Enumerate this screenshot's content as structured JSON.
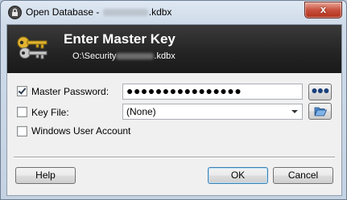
{
  "window": {
    "title_prefix": "Open Database - ",
    "title_suffix": ".kdbx",
    "close_glyph": "x"
  },
  "banner": {
    "title": "Enter Master Key",
    "path_prefix": "O:\\Security",
    "path_suffix": ".kdbx"
  },
  "form": {
    "master_password": {
      "label": "Master Password:",
      "checked": true,
      "value": "●●●●●●●●●●●●●●●●",
      "reveal_button": "●●●"
    },
    "key_file": {
      "label": "Key File:",
      "checked": false,
      "selected": "(None)",
      "browse_icon": "folder-open-icon"
    },
    "windows_user_account": {
      "label": "Windows User Account",
      "checked": false
    }
  },
  "buttons": {
    "help": "Help",
    "ok": "OK",
    "cancel": "Cancel"
  },
  "icons": [
    "lock-app-icon",
    "keys-icon",
    "folder-open-icon",
    "close-icon"
  ],
  "colors": {
    "banner_bg": "#232323",
    "close_button": "#c7503c",
    "default_button_border": "#3c7fb1"
  }
}
